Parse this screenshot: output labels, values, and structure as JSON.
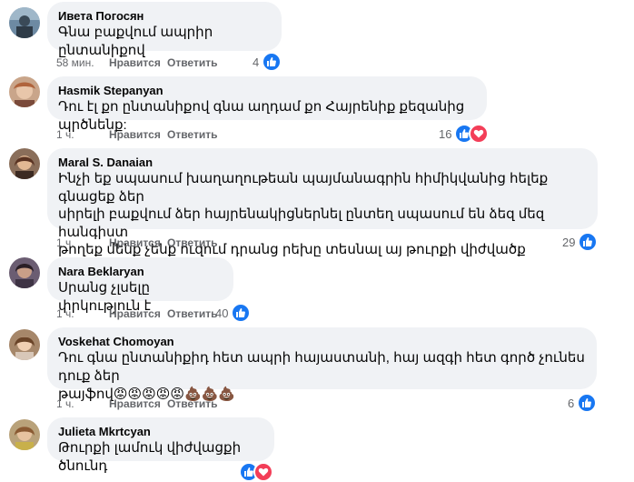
{
  "comments": [
    {
      "author": "Ивета Погосян",
      "text": "Գնա բաքվում ապրիր ընտանիքով",
      "time": "58 мин.",
      "like_label": "Нравится",
      "reply_label": "Ответить",
      "reaction_count": "4",
      "reactions": [
        "like-icon"
      ]
    },
    {
      "author": "Hasmik Stepanyan",
      "text": "Դու էլ քո ընտանիքով գնա աղդամ քո Հայրենիք քեզանից պրծնենք:",
      "time": "1 ч.",
      "like_label": "Нравится",
      "reply_label": "Ответить",
      "reaction_count": "16",
      "reactions": [
        "like-icon",
        "love-icon"
      ]
    },
    {
      "author": "Maral S. Danaian",
      "text": "Ինչի եք սպասում խաղաղութեան պայմանագրին հիմիկվանից հելեք գնացեք ձեր\nսիրելի բաքվում ձեր հայրենակիցներնել ընտեղ սպասում են ձեզ մեզ հանգիստ\nթողեք մենք չենք ուզում դրանց րեխը տեսնալ այ թուրքի վիժվածք",
      "time": "1 ч.",
      "like_label": "Нравится",
      "reply_label": "Ответить",
      "reaction_count": "29",
      "reactions": [
        "like-icon"
      ]
    },
    {
      "author": "Nara Beklaryan",
      "text": "Սրանց չլսելը փրկություն է",
      "time": "1 ч.",
      "like_label": "Нравится",
      "reply_label": "Ответить",
      "reaction_count": "40",
      "reactions": [
        "like-icon"
      ]
    },
    {
      "author": "Voskehat Chomoyan",
      "text": "Դու գնա ընտանիքիդ հետ ապրի հայաստանի, հայ ազգի հետ գործ չունես դուք ձեր\nթայֆով😡😡😡😡😡💩💩💩",
      "time": "1 ч.",
      "like_label": "Нравится",
      "reply_label": "Ответить",
      "reaction_count": "6",
      "reactions": [
        "like-icon"
      ]
    },
    {
      "author": "Julieta Mkrtcyan",
      "text": "Թուրքի լամուկ վիժվացքի ծնունդ",
      "time": "",
      "like_label": "",
      "reply_label": "",
      "reaction_count": "",
      "reactions": [
        "like-icon",
        "love-icon"
      ]
    }
  ],
  "colors": {
    "bubble": "#f0f2f5",
    "meta_text": "#65676b",
    "like_blue": "#1877f2",
    "love_red": "#f33e58"
  }
}
